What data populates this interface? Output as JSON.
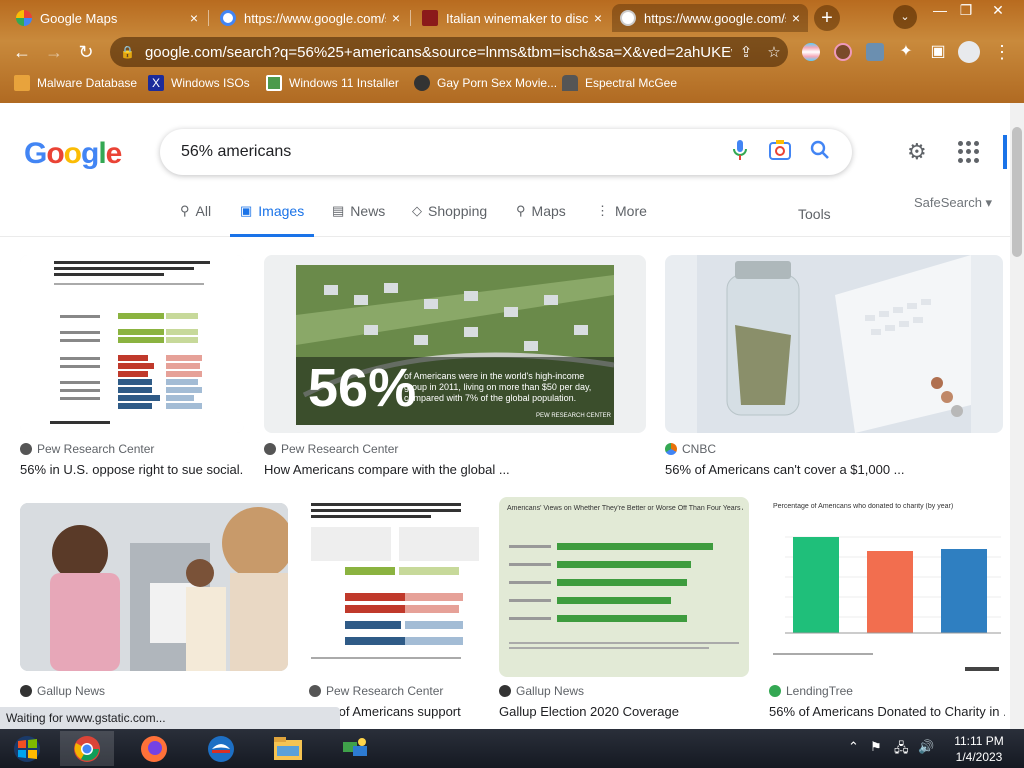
{
  "browser": {
    "tabs": [
      {
        "title": "Google Maps",
        "close": "×"
      },
      {
        "title": "https://www.google.com/s",
        "close": "×"
      },
      {
        "title": "Italian winemaker to disc",
        "close": "×"
      },
      {
        "title": "https://www.google.com/s",
        "close": "×"
      }
    ],
    "new_tab": "+",
    "tab_search": "⌄",
    "window_controls": {
      "minimize": "—",
      "restore": "❐",
      "close": "✕"
    },
    "url": "google.com/search?q=56%25+americans&source=lnms&tbm=isch&sa=X&ved=2ahUKEwi...",
    "bookmarks": [
      {
        "label": "Malware Database"
      },
      {
        "label": "Windows ISOs"
      },
      {
        "label": "Windows 11 Installer"
      },
      {
        "label": "Gay Porn Sex Movie..."
      },
      {
        "label": "Espectral McGee"
      }
    ]
  },
  "google": {
    "logo_letters": [
      "G",
      "o",
      "o",
      "g",
      "l",
      "e"
    ],
    "logo_colors": [
      "#4285f4",
      "#ea4335",
      "#fbbc05",
      "#4285f4",
      "#34a853",
      "#ea4335"
    ],
    "query": "56% americans",
    "tabs": [
      {
        "label": "All",
        "icon": "search-icon"
      },
      {
        "label": "Images",
        "icon": "image-icon",
        "active": true
      },
      {
        "label": "News",
        "icon": "news-icon"
      },
      {
        "label": "Shopping",
        "icon": "tag-icon"
      },
      {
        "label": "Maps",
        "icon": "map-pin-icon"
      },
      {
        "label": "More",
        "icon": "more-vert-icon"
      }
    ],
    "tools": "Tools",
    "safesearch": "SafeSearch ▾",
    "results": [
      {
        "source": "Pew Research Center",
        "title": "56% in U.S. oppose right to sue social...",
        "img_caption_big": "",
        "src_color": "#555"
      },
      {
        "source": "Pew Research Center",
        "title": "How Americans compare with the global ...",
        "img_caption_big": "56%",
        "img_caption_small": "of Americans were in the world's high-income group in 2011, living on more than $50 per day, compared with 7% of the global population.",
        "img_credit": "PEW RESEARCH CENTER",
        "src_color": "#555"
      },
      {
        "source": "CNBC",
        "title": "56% of Americans can't cover a $1,000 ...",
        "src_color": "#e8710a"
      },
      {
        "source": "Gallup News",
        "title": "",
        "src_color": "#333"
      },
      {
        "source": "Pew Research Center",
        "title": "56% of Americans support",
        "src_color": "#555"
      },
      {
        "source": "Gallup News",
        "title": "Gallup Election 2020 Coverage",
        "chart_title": "Americans' Views on Whether They're Better or Worse Off Than Four Years Ago",
        "src_color": "#333"
      },
      {
        "source": "LendingTree",
        "title": "56% of Americans Donated to Charity in ...",
        "chart_title": "Percentage of Americans who donated to charity (by year)",
        "src_color": "#34a853"
      }
    ],
    "status": "Waiting for www.gstatic.com..."
  },
  "taskbar": {
    "clock_time": "11:11 PM",
    "clock_date": "1/4/2023"
  }
}
